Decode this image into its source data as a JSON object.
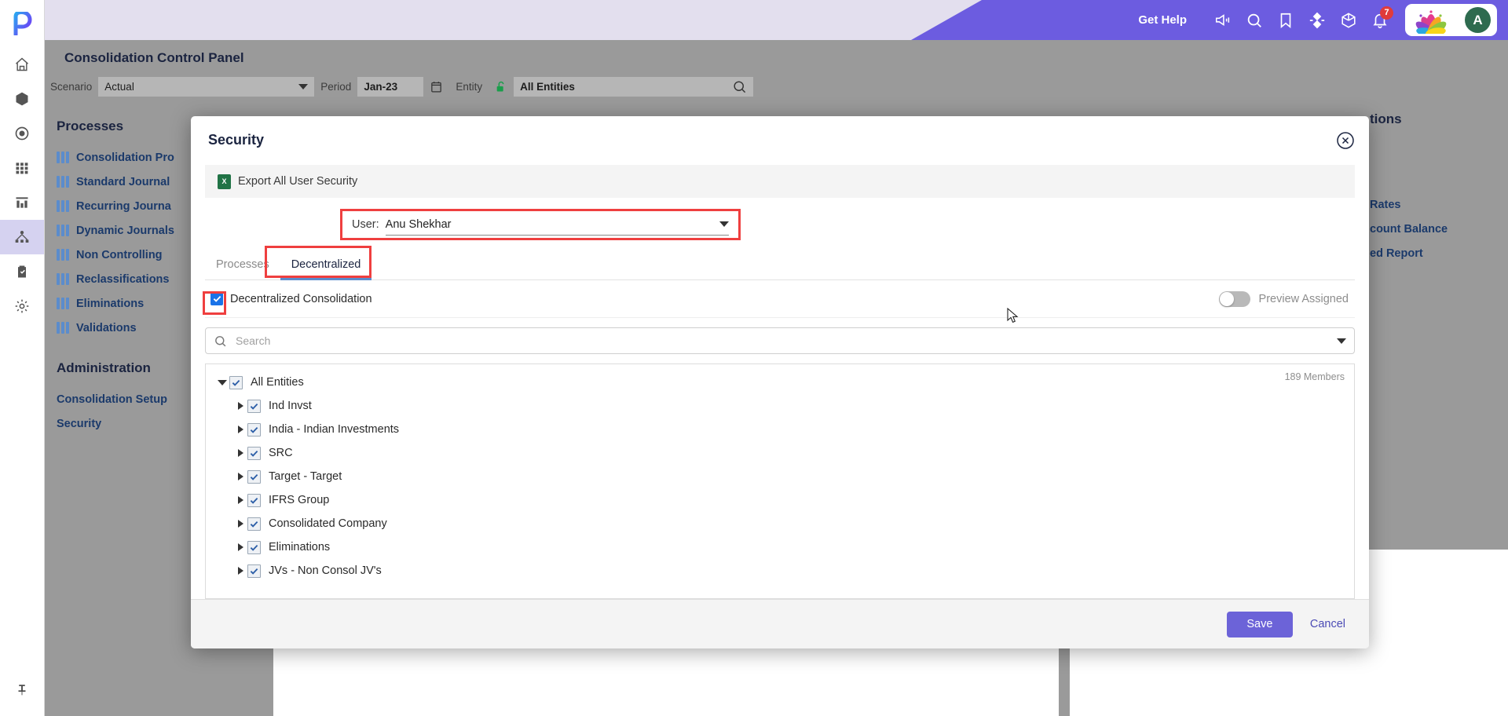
{
  "topbar": {
    "get_help": "Get Help",
    "icons": [
      "megaphone-icon",
      "search-icon",
      "bookmark-icon",
      "compass-icon",
      "cube-icon",
      "bell-icon"
    ],
    "notification_count": "7",
    "avatar_initial": "A"
  },
  "rail": {
    "logo": "p-logo",
    "items": [
      {
        "name": "home-icon"
      },
      {
        "name": "cube-icon"
      },
      {
        "name": "target-icon"
      },
      {
        "name": "grid-icon"
      },
      {
        "name": "chart-icon"
      },
      {
        "name": "hierarchy-icon",
        "active": true
      },
      {
        "name": "clipboard-icon"
      },
      {
        "name": "gear-icon"
      }
    ],
    "pin": "pin-icon"
  },
  "page": {
    "title": "Consolidation Control Panel"
  },
  "filters": {
    "scenario_label": "Scenario",
    "scenario_value": "Actual",
    "period_label": "Period",
    "period_value": "Jan-23",
    "entity_label": "Entity",
    "entity_value": "All Entities"
  },
  "left_panel": {
    "processes_heading": "Processes",
    "processes": [
      "Consolidation Pro",
      "Standard Journal",
      "Recurring Journa",
      "Dynamic Journals",
      "Non Controlling",
      "Reclassifications",
      "Eliminations",
      "Validations"
    ],
    "administration_heading": "Administration",
    "administration": [
      "Consolidation Setup",
      "Security"
    ]
  },
  "right_panel": {
    "heading": "tions",
    "links": [
      "Rates",
      "count Balance",
      "ed Report"
    ]
  },
  "modal": {
    "title": "Security",
    "close_icon": "close-icon",
    "export_label": "Export All User Security",
    "export_icon": "excel-icon",
    "user_label": "User:",
    "user_value": "Anu Shekhar",
    "tabs": [
      {
        "label": "Processes",
        "active": false
      },
      {
        "label": "Decentralized",
        "active": true
      }
    ],
    "decentralized_checkbox_label": "Decentralized Consolidation",
    "decentralized_checked": true,
    "preview_assigned_label": "Preview Assigned",
    "preview_assigned_on": false,
    "search_placeholder": "Search",
    "search_value": "",
    "member_count": "189 Members",
    "tree": {
      "root": {
        "label": "All Entities",
        "expanded": true,
        "checked": true
      },
      "children": [
        {
          "label": "Ind Invst",
          "checked": true
        },
        {
          "label": "India - Indian Investments",
          "checked": true
        },
        {
          "label": "SRC",
          "checked": true
        },
        {
          "label": "Target - Target",
          "checked": true
        },
        {
          "label": "IFRS Group",
          "checked": true
        },
        {
          "label": "Consolidated Company",
          "checked": true
        },
        {
          "label": "Eliminations",
          "checked": true
        },
        {
          "label": "JVs - Non Consol JV's",
          "checked": true
        }
      ]
    },
    "save_label": "Save",
    "cancel_label": "Cancel"
  },
  "colors": {
    "brand_purple": "#6c5ce0",
    "save_purple": "#6c63d8",
    "highlight_red": "#ef3f3f",
    "checkbox_blue": "#1a73e8",
    "tab_underline": "#5b8ccc"
  }
}
